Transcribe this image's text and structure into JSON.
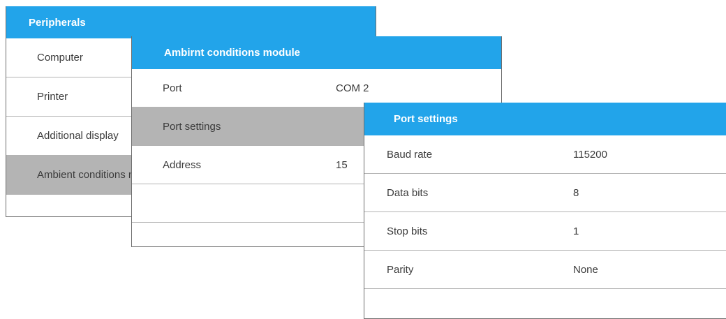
{
  "peripherals": {
    "title": "Peripherals",
    "items": [
      {
        "label": "Computer"
      },
      {
        "label": "Printer"
      },
      {
        "label": "Additional display"
      },
      {
        "label": "Ambient conditions module"
      }
    ]
  },
  "ambient_module": {
    "title": "Ambirnt conditions module",
    "items": [
      {
        "label": "Port",
        "value": "COM 2"
      },
      {
        "label": "Port settings",
        "value": ""
      },
      {
        "label": "Address",
        "value": "15"
      }
    ]
  },
  "port_settings": {
    "title": "Port settings",
    "items": [
      {
        "label": "Baud rate",
        "value": "115200"
      },
      {
        "label": "Data bits",
        "value": "8"
      },
      {
        "label": "Stop bits",
        "value": "1"
      },
      {
        "label": "Parity",
        "value": "None"
      }
    ]
  },
  "colors": {
    "header": "#22a4ea",
    "selected_row": "#b4b4b4"
  }
}
